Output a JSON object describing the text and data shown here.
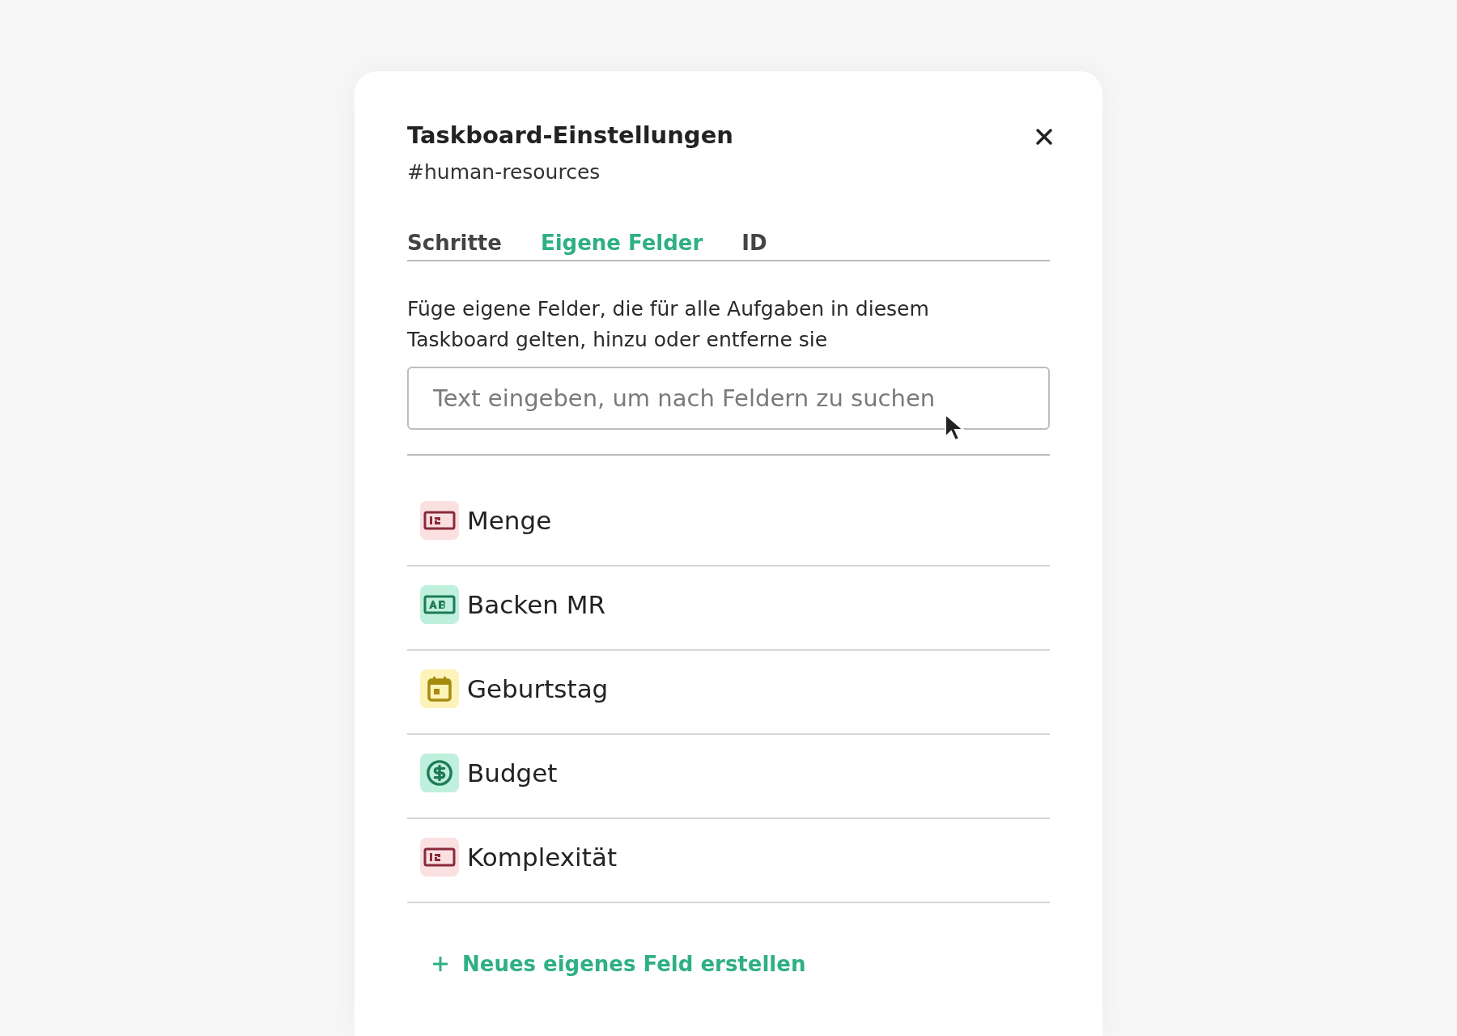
{
  "dialog": {
    "title": "Taskboard-Einstellungen",
    "subtitle": "#human-resources"
  },
  "tabs": [
    {
      "label": "Schritte",
      "selected": false
    },
    {
      "label": "Eigene Felder",
      "selected": true
    },
    {
      "label": "ID",
      "selected": false
    }
  ],
  "description": "Füge eigene Felder, die für alle Aufgaben in diesem Taskboard gelten, hinzu oder entferne sie",
  "search": {
    "placeholder": "Text eingeben, um nach Feldern zu suchen"
  },
  "fields": [
    {
      "name": "Menge",
      "kind": "number"
    },
    {
      "name": "Backen MR",
      "kind": "text"
    },
    {
      "name": "Geburtstag",
      "kind": "date"
    },
    {
      "name": "Budget",
      "kind": "currency"
    },
    {
      "name": "Komplexität",
      "kind": "number"
    }
  ],
  "add_button": {
    "label": "Neues eigenes Feld erstellen"
  }
}
